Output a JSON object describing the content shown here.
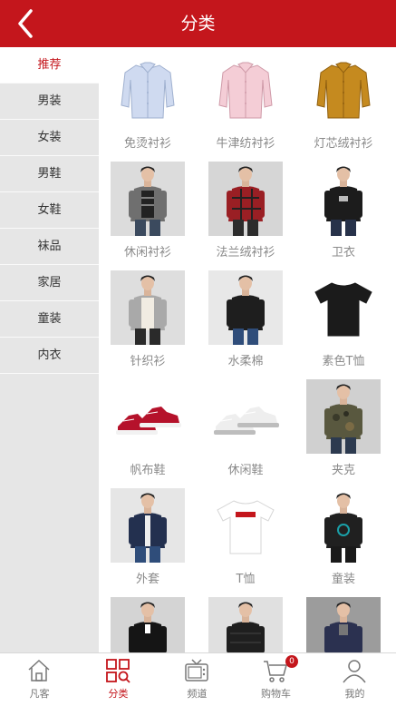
{
  "header": {
    "title": "分类",
    "back_icon": "chevron-left-icon"
  },
  "sidebar": {
    "active_index": 0,
    "items": [
      {
        "label": "推荐"
      },
      {
        "label": "男装"
      },
      {
        "label": "女装"
      },
      {
        "label": "男鞋"
      },
      {
        "label": "女鞋"
      },
      {
        "label": "袜品"
      },
      {
        "label": "家居"
      },
      {
        "label": "童装"
      },
      {
        "label": "内衣"
      }
    ]
  },
  "products": [
    {
      "label": "免烫衬衫",
      "image": "light-blue-shirt"
    },
    {
      "label": "牛津纺衬衫",
      "image": "pink-shirt"
    },
    {
      "label": "灯芯绒衬衫",
      "image": "mustard-corduroy-shirt"
    },
    {
      "label": "休闲衬衫",
      "image": "man-gray-casual-shirt-photo"
    },
    {
      "label": "法兰绒衬衫",
      "image": "man-red-plaid-shirt-photo"
    },
    {
      "label": "卫衣",
      "image": "man-black-sweatshirt-photo"
    },
    {
      "label": "针织衫",
      "image": "man-gray-cardigan-photo"
    },
    {
      "label": "水柔棉",
      "image": "man-black-long-sleeve-photo"
    },
    {
      "label": "素色T恤",
      "image": "black-tshirt"
    },
    {
      "label": "帆布鞋",
      "image": "red-canvas-sneakers"
    },
    {
      "label": "休闲鞋",
      "image": "white-casual-shoes"
    },
    {
      "label": "夹克",
      "image": "man-camo-jacket-photo"
    },
    {
      "label": "外套",
      "image": "man-navy-jacket-photo"
    },
    {
      "label": "T恤",
      "image": "white-tshirt"
    },
    {
      "label": "童装",
      "image": "child-black-outfit-photo"
    },
    {
      "label": "",
      "image": "man-black-coat-photo"
    },
    {
      "label": "",
      "image": "man-black-puffer-photo"
    },
    {
      "label": "",
      "image": "man-navy-puffer-photo"
    }
  ],
  "tabbar": {
    "active_index": 1,
    "items": [
      {
        "label": "凡客",
        "icon": "home-icon"
      },
      {
        "label": "分类",
        "icon": "category-grid-icon"
      },
      {
        "label": "频道",
        "icon": "tv-icon"
      },
      {
        "label": "购物车",
        "icon": "cart-icon"
      },
      {
        "label": "我的",
        "icon": "user-icon"
      }
    ],
    "cart_badge": "0"
  },
  "colors": {
    "accent": "#c4161c",
    "sidebar_bg": "#e6e6e6",
    "label_gray": "#8a8a8a"
  }
}
